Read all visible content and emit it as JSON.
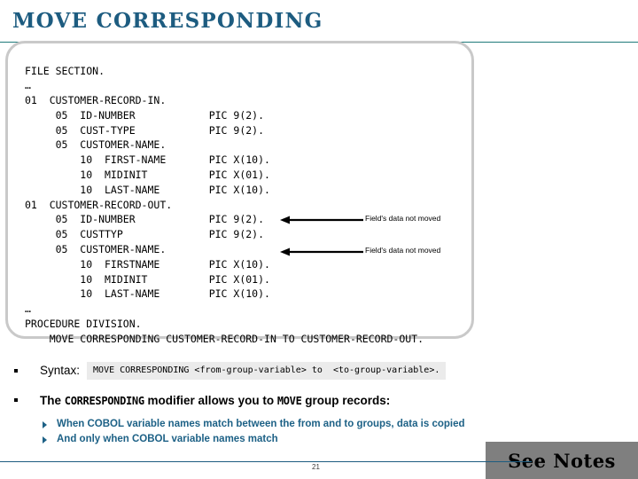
{
  "slide": {
    "title": "MOVE CORRESPONDING",
    "page_number": "21",
    "accent_color": "#1d5c80",
    "rule_color": "#1f7a7a"
  },
  "code_panel": {
    "listing": "FILE SECTION.\n…\n01  CUSTOMER-RECORD-IN.\n     05  ID-NUMBER            PIC 9(2).\n     05  CUST-TYPE            PIC 9(2).\n     05  CUSTOMER-NAME.\n         10  FIRST-NAME       PIC X(10).\n         10  MIDINIT          PIC X(01).\n         10  LAST-NAME        PIC X(10).\n01  CUSTOMER-RECORD-OUT.\n     05  ID-NUMBER            PIC 9(2).\n     05  CUSTTYP              PIC 9(2).\n     05  CUSTOMER-NAME.\n         10  FIRSTNAME        PIC X(10).\n         10  MIDINIT          PIC X(01).\n         10  LAST-NAME        PIC X(10).\n…\nPROCEDURE DIVISION.\n    MOVE CORRESPONDING CUSTOMER-RECORD-IN TO CUSTOMER-RECORD-OUT."
  },
  "annotations": [
    {
      "label": "Field's data not moved",
      "target": "CUSTTYP"
    },
    {
      "label": "Field's data not moved",
      "target": "FIRSTNAME"
    }
  ],
  "bullets": {
    "syntax_label": "Syntax:",
    "syntax_code": "MOVE CORRESPONDING <from-group-variable> to  <to-group-variable>.",
    "corresponding": {
      "part1": "The ",
      "mono1": "CORRESPONDING",
      "part2": " modifier allows you to ",
      "mono2": "MOVE",
      "part3": " group records:"
    },
    "sub_items": [
      "When COBOL variable names match between the from and to groups, data is copied",
      "And only when COBOL variable names match"
    ]
  },
  "see_notes": {
    "label": "See Notes"
  }
}
